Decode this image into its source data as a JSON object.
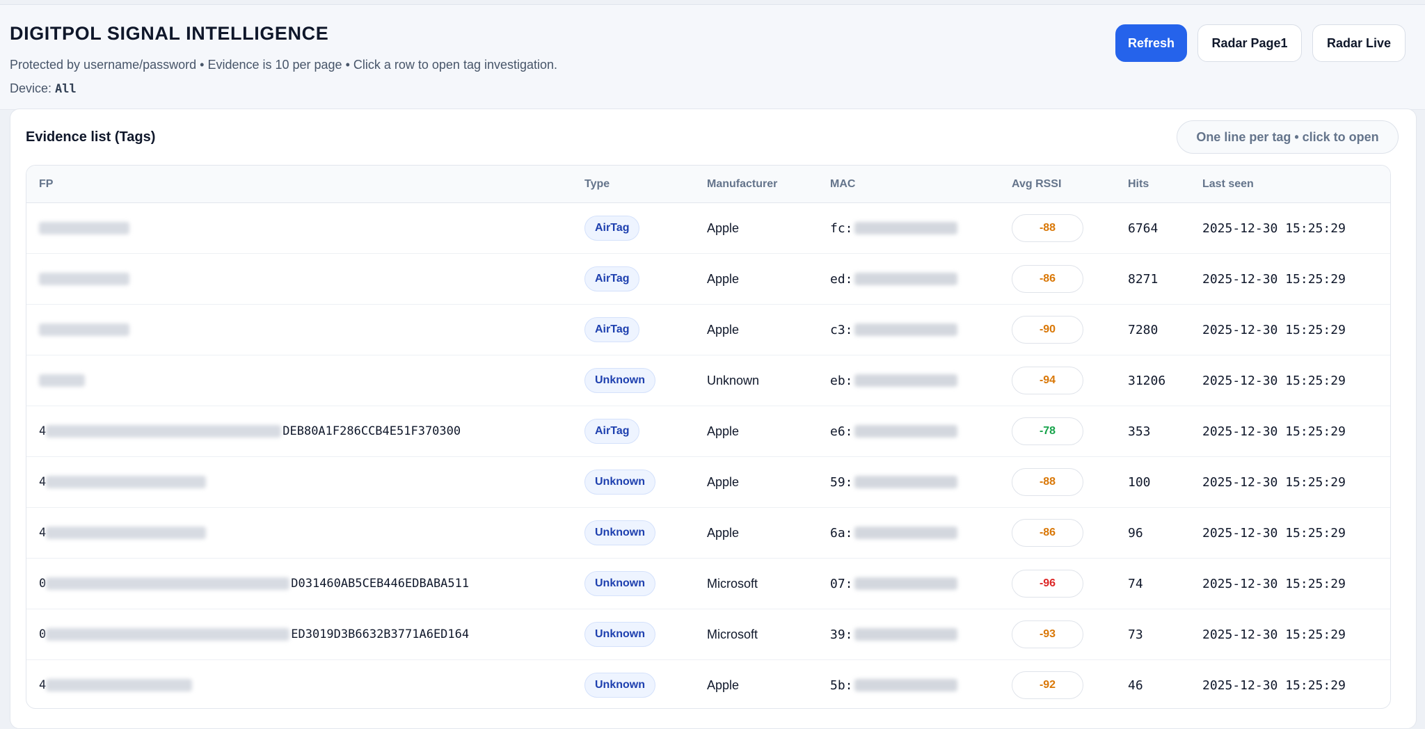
{
  "header": {
    "title": "DIGITPOL SIGNAL INTELLIGENCE",
    "subtitle": "Protected by username/password • Evidence is 10 per page • Click a row to open tag investigation.",
    "device_label": "Device:",
    "device_value": "All",
    "buttons": {
      "refresh": "Refresh",
      "radar_page1": "Radar Page1",
      "radar_live": "Radar Live"
    }
  },
  "card": {
    "title": "Evidence list (Tags)",
    "pill": "One line per tag • click to open"
  },
  "table": {
    "columns": [
      "FP",
      "Type",
      "Manufacturer",
      "MAC",
      "Avg RSSI",
      "Hits",
      "Last seen"
    ],
    "rows": [
      {
        "fp_prefix": "",
        "fp_blur": 130,
        "fp_suffix": "",
        "type": "AirTag",
        "manufacturer": "Apple",
        "mac_prefix": "fc:",
        "rssi": "-88",
        "rssi_color": "#d97706",
        "hits": "6764",
        "last_seen": "2025-12-30 15:25:29"
      },
      {
        "fp_prefix": "",
        "fp_blur": 130,
        "fp_suffix": "",
        "type": "AirTag",
        "manufacturer": "Apple",
        "mac_prefix": "ed:",
        "rssi": "-86",
        "rssi_color": "#d97706",
        "hits": "8271",
        "last_seen": "2025-12-30 15:25:29"
      },
      {
        "fp_prefix": "",
        "fp_blur": 130,
        "fp_suffix": "",
        "type": "AirTag",
        "manufacturer": "Apple",
        "mac_prefix": "c3:",
        "rssi": "-90",
        "rssi_color": "#d97706",
        "hits": "7280",
        "last_seen": "2025-12-30 15:25:29"
      },
      {
        "fp_prefix": "",
        "fp_blur": 66,
        "fp_suffix": "",
        "type": "Unknown",
        "manufacturer": "Unknown",
        "mac_prefix": "eb:",
        "rssi": "-94",
        "rssi_color": "#d97706",
        "hits": "31206",
        "last_seen": "2025-12-30 15:25:29"
      },
      {
        "fp_prefix": "4",
        "fp_blur": 338,
        "fp_suffix": "DEB80A1F286CCB4E51F370300",
        "type": "AirTag",
        "manufacturer": "Apple",
        "mac_prefix": "e6:",
        "rssi": "-78",
        "rssi_color": "#16a34a",
        "hits": "353",
        "last_seen": "2025-12-30 15:25:29"
      },
      {
        "fp_prefix": "4",
        "fp_blur": 230,
        "fp_suffix": "",
        "type": "Unknown",
        "manufacturer": "Apple",
        "mac_prefix": "59:",
        "rssi": "-88",
        "rssi_color": "#d97706",
        "hits": "100",
        "last_seen": "2025-12-30 15:25:29"
      },
      {
        "fp_prefix": "4",
        "fp_blur": 230,
        "fp_suffix": "",
        "type": "Unknown",
        "manufacturer": "Apple",
        "mac_prefix": "6a:",
        "rssi": "-86",
        "rssi_color": "#d97706",
        "hits": "96",
        "last_seen": "2025-12-30 15:25:29"
      },
      {
        "fp_prefix": "0",
        "fp_blur": 350,
        "fp_suffix": "D031460AB5CEB446EDBABA511",
        "type": "Unknown",
        "manufacturer": "Microsoft",
        "mac_prefix": "07:",
        "rssi": "-96",
        "rssi_color": "#dc2626",
        "hits": "74",
        "last_seen": "2025-12-30 15:25:29"
      },
      {
        "fp_prefix": "0",
        "fp_blur": 350,
        "fp_suffix": "ED3019D3B6632B3771A6ED164",
        "type": "Unknown",
        "manufacturer": "Microsoft",
        "mac_prefix": "39:",
        "rssi": "-93",
        "rssi_color": "#d97706",
        "hits": "73",
        "last_seen": "2025-12-30 15:25:29"
      },
      {
        "fp_prefix": "4",
        "fp_blur": 210,
        "fp_suffix": "",
        "type": "Unknown",
        "manufacturer": "Apple",
        "mac_prefix": "5b:",
        "rssi": "-92",
        "rssi_color": "#d97706",
        "hits": "46",
        "last_seen": "2025-12-30 15:25:29"
      }
    ]
  }
}
